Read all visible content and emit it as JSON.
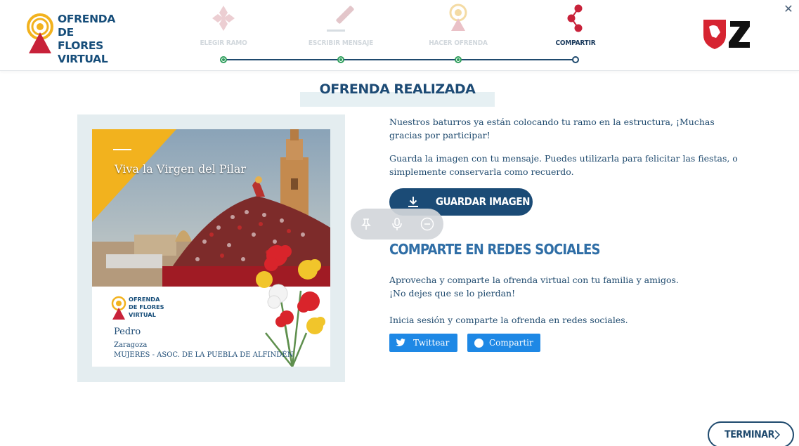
{
  "header": {
    "brand": [
      "OFRENDA",
      "DE FLORES",
      "VIRTUAL"
    ],
    "steps": [
      {
        "label": "ELEGIR RAMO",
        "state": "done"
      },
      {
        "label": "ESCRIBIR MENSAJE",
        "state": "done"
      },
      {
        "label": "HACER OFRENDA",
        "state": "done"
      },
      {
        "label": "COMPARTIR",
        "state": "active"
      }
    ],
    "partner_logo": "Z"
  },
  "main": {
    "title": "OFRENDA REALIZADA",
    "card": {
      "message": "Viva la Virgen del Pilar",
      "brand": [
        "OFRENDA",
        "DE FLORES",
        "VIRTUAL"
      ],
      "name": "Pedro",
      "city": "Zaragoza",
      "group": "MUJERES - ASOC. DE LA PUEBLA DE ALFINDÉN"
    },
    "thanks_text": "Nuestros baturros ya están colocando tu ramo en la estructura, ¡Muchas gracias por participar!",
    "save_text": "Guarda la imagen con tu mensaje. Puedes utilizarla para felicitar las fiestas, o simplemente conservarla como recuerdo.",
    "save_button": "GUARDAR IMAGEN",
    "social_title": "COMPARTE EN REDES SOCIALES",
    "share_text_line1": "Aprovecha y comparte la ofrenda virtual con tu familia y amigos.",
    "share_text_line2": "¡No dejes que se lo pierdan!",
    "login_text": "Inicia sesión y comparte la ofrenda en redes sociales.",
    "twitter_button": "Twittear",
    "facebook_button": "Compartir"
  },
  "footer": {
    "finish_button": "TERMINAR"
  },
  "colors": {
    "primary": "#1b4b76",
    "accent_gold": "#f2b21e",
    "social_blue": "#1e88e5",
    "step_done": "#2e9e5c"
  }
}
